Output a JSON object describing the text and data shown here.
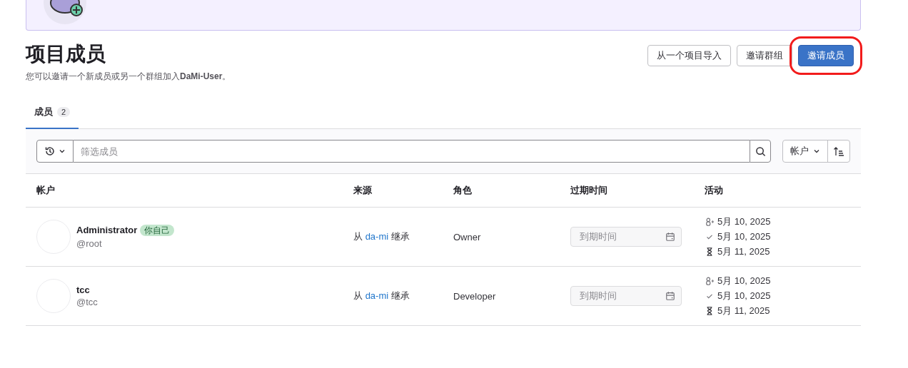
{
  "header": {
    "title": "项目成员",
    "description": "您可以邀请一个新成员或另一个群组加入**DaMi-User**。"
  },
  "actions": [
    {
      "label": "从一个项目导入",
      "kind": "secondary",
      "highlighted": false
    },
    {
      "label": "邀请群组",
      "kind": "secondary",
      "highlighted": false
    },
    {
      "label": "邀请成员",
      "kind": "primary",
      "highlighted": true
    }
  ],
  "tabs": [
    {
      "label": "成员",
      "count": "2",
      "selected": true
    }
  ],
  "filter": {
    "placeholder": "筛选成员",
    "sort_field": "帐户"
  },
  "table": {
    "columns": [
      "帐户",
      "来源",
      "角色",
      "过期时间",
      "活动"
    ],
    "rows": [
      {
        "name": "Administrator",
        "badge": "你自己",
        "username": "@root",
        "source_prefix": "从",
        "source_link": "da-mi",
        "source_suffix": "继承",
        "role": "Owner",
        "expiry_placeholder": "到期时间",
        "activity": [
          {
            "kind": "joined",
            "date": "5月 10, 2025"
          },
          {
            "kind": "access",
            "date": "5月 10, 2025"
          },
          {
            "kind": "last",
            "date": "5月 11, 2025"
          }
        ]
      },
      {
        "name": "tcc",
        "username": "@tcc",
        "source_prefix": "从",
        "source_link": "da-mi",
        "source_suffix": "继承",
        "role": "Developer",
        "expiry_placeholder": "到期时间",
        "activity": [
          {
            "kind": "joined",
            "date": "5月 10, 2025"
          },
          {
            "kind": "access",
            "date": "5月 10, 2025"
          },
          {
            "kind": "last",
            "date": "5月 11, 2025"
          }
        ]
      }
    ]
  }
}
